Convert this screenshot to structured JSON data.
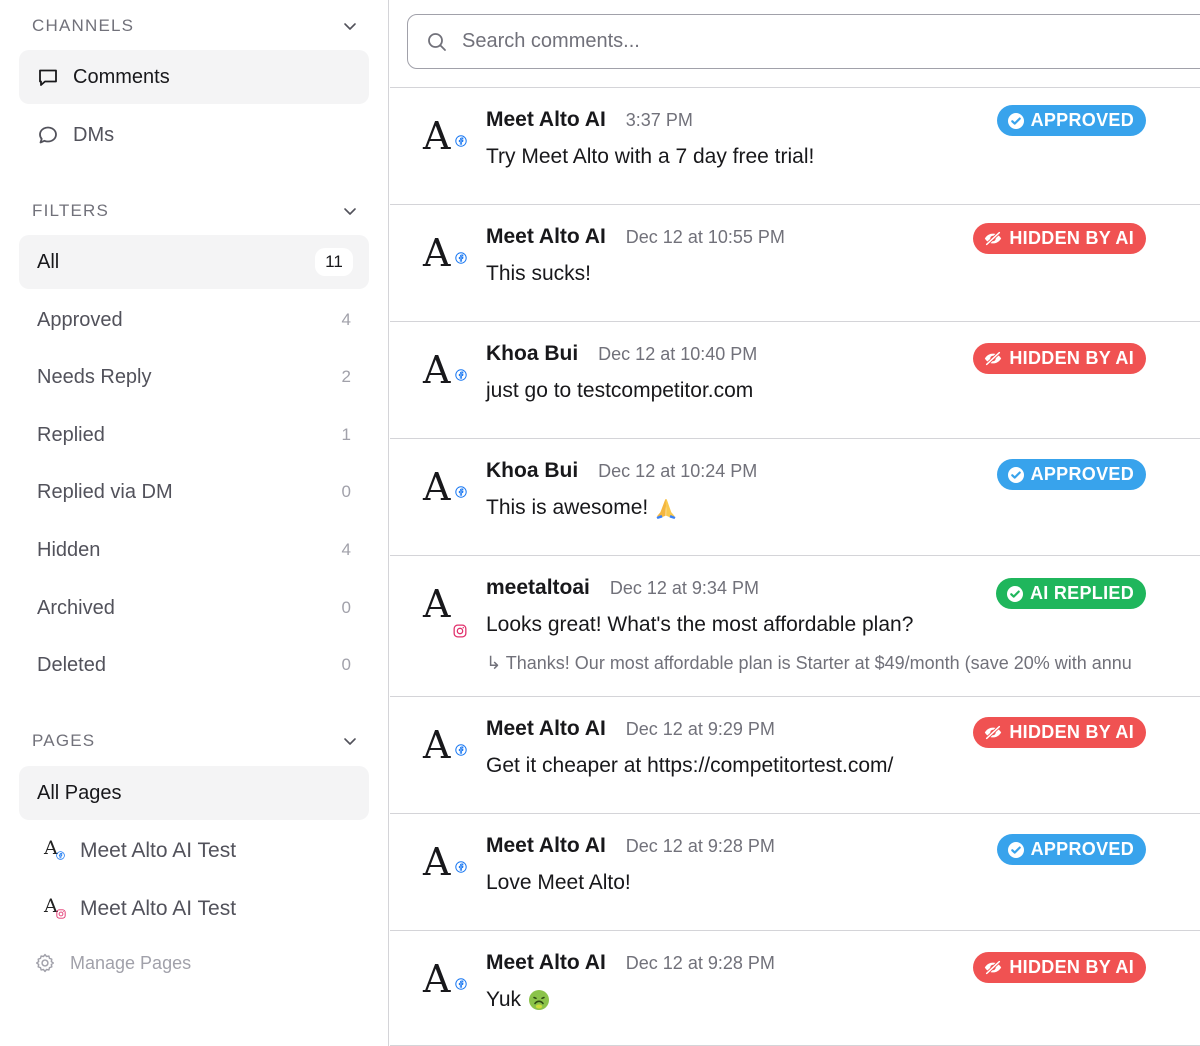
{
  "sidebar": {
    "channels": {
      "title": "CHANNELS",
      "items": [
        {
          "label": "Comments",
          "icon": "comment-square-icon",
          "active": true
        },
        {
          "label": "DMs",
          "icon": "chat-bubble-icon",
          "active": false
        }
      ]
    },
    "filters": {
      "title": "FILTERS",
      "items": [
        {
          "label": "All",
          "count": "11",
          "active": true
        },
        {
          "label": "Approved",
          "count": "4"
        },
        {
          "label": "Needs Reply",
          "count": "2"
        },
        {
          "label": "Replied",
          "count": "1"
        },
        {
          "label": "Replied via DM",
          "count": "0"
        },
        {
          "label": "Hidden",
          "count": "4"
        },
        {
          "label": "Archived",
          "count": "0"
        },
        {
          "label": "Deleted",
          "count": "0"
        }
      ]
    },
    "pages": {
      "title": "PAGES",
      "all_label": "All Pages",
      "items": [
        {
          "label": "Meet Alto AI Test",
          "logo": "A",
          "platform": "facebook"
        },
        {
          "label": "Meet Alto AI Test",
          "logo": "A",
          "platform": "instagram"
        }
      ],
      "manage_label": "Manage Pages"
    }
  },
  "search": {
    "placeholder": "Search comments..."
  },
  "comments": [
    {
      "logo": "A",
      "author": "Meet Alto AI",
      "time": "3:37 PM",
      "text": "Try Meet Alto with a 7 day free trial!",
      "status": "APPROVED",
      "platform": "facebook"
    },
    {
      "logo": "A",
      "author": "Meet Alto AI",
      "time": "Dec 12 at 10:55 PM",
      "text": "This sucks!",
      "status": "HIDDEN BY AI",
      "platform": "facebook"
    },
    {
      "logo": "A",
      "author": "Khoa Bui",
      "time": "Dec 12 at 10:40 PM",
      "text": "just go to testcompetitor.com",
      "status": "HIDDEN BY AI",
      "platform": "facebook"
    },
    {
      "logo": "A",
      "author": "Khoa Bui",
      "time": "Dec 12 at 10:24 PM",
      "text": "This is awesome!",
      "status": "APPROVED",
      "platform": "facebook",
      "emoji": "folded-hands"
    },
    {
      "logo": "A",
      "author": "meetaltoai",
      "time": "Dec 12 at 9:34 PM",
      "text": "Looks great! What's the most affordable plan?",
      "status": "AI REPLIED",
      "platform": "instagram",
      "reply_arrow": "↳",
      "reply": "Thanks! Our most affordable plan is Starter at $49/month (save 20% with annu"
    },
    {
      "logo": "A",
      "author": "Meet Alto AI",
      "time": "Dec 12 at 9:29 PM",
      "text": "Get it cheaper at https://competitortest.com/",
      "status": "HIDDEN BY AI",
      "platform": "facebook"
    },
    {
      "logo": "A",
      "author": "Meet Alto AI",
      "time": "Dec 12 at 9:28 PM",
      "text": "Love Meet Alto!",
      "status": "APPROVED",
      "platform": "facebook"
    },
    {
      "logo": "A",
      "author": "Meet Alto AI",
      "time": "Dec 12 at 9:28 PM",
      "text": "Yuk",
      "status": "HIDDEN BY AI",
      "platform": "facebook",
      "emoji": "nauseated-face"
    }
  ],
  "colors": {
    "approved": "#38a3ec",
    "hidden": "#f05252",
    "replied": "#1fb65c",
    "facebook": "#1877f2",
    "instagram": "#e1306c"
  }
}
